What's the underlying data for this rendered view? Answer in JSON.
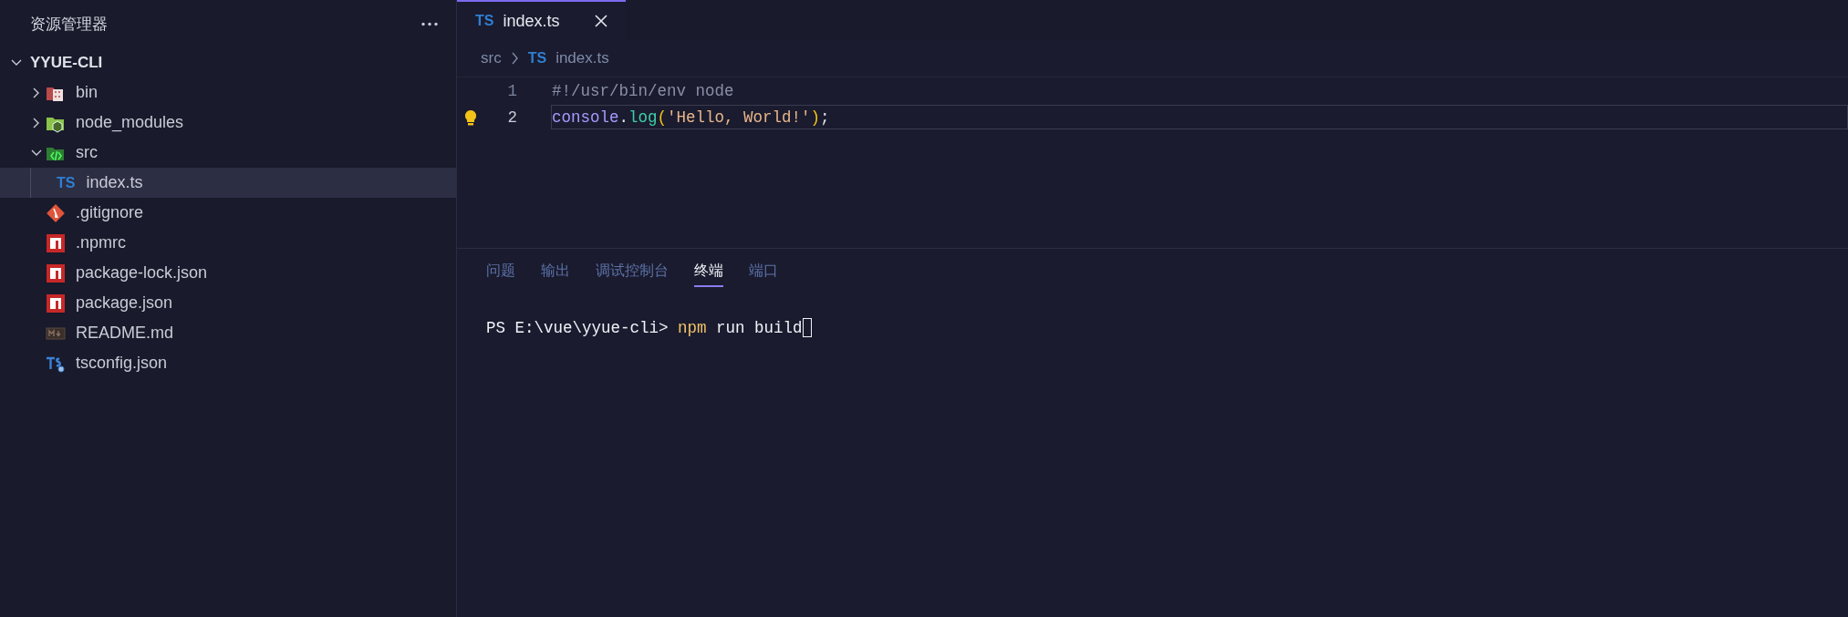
{
  "sidebar": {
    "title": "资源管理器",
    "tree": {
      "label": "YYUE-CLI",
      "expanded": true,
      "children": [
        {
          "label": "bin",
          "kind": "binfolder",
          "expanded": false,
          "selected": false
        },
        {
          "label": "node_modules",
          "kind": "nodefolder",
          "expanded": false,
          "selected": false
        },
        {
          "label": "src",
          "kind": "srcfolder",
          "expanded": true,
          "selected": false,
          "children": [
            {
              "label": "index.ts",
              "kind": "ts",
              "icon": "TS",
              "selected": true
            }
          ]
        },
        {
          "label": ".gitignore",
          "kind": "git",
          "selected": false
        },
        {
          "label": ".npmrc",
          "kind": "npm",
          "selected": false
        },
        {
          "label": "package-lock.json",
          "kind": "npm",
          "selected": false
        },
        {
          "label": "package.json",
          "kind": "npm",
          "selected": false
        },
        {
          "label": "README.md",
          "kind": "markdown",
          "selected": false
        },
        {
          "label": "tsconfig.json",
          "kind": "tsconfig",
          "selected": false
        }
      ]
    }
  },
  "editor": {
    "tabs": [
      {
        "label": "index.ts",
        "icon": "TS",
        "selected": true
      }
    ],
    "breadcrumb": [
      {
        "label": "src"
      },
      {
        "label": "index.ts",
        "icon": "TS"
      }
    ],
    "lines": [
      {
        "number": "1",
        "current": false,
        "lightbulb": false,
        "tokens": [
          {
            "text": "#!/usr/bin/env node",
            "kind": "comment"
          }
        ]
      },
      {
        "number": "2",
        "current": true,
        "lightbulb": true,
        "tokens": [
          {
            "text": "console",
            "kind": "variable"
          },
          {
            "text": ".",
            "kind": "plain"
          },
          {
            "text": "log",
            "kind": "function"
          },
          {
            "text": "(",
            "kind": "paren"
          },
          {
            "text": "'Hello, World!'",
            "kind": "string"
          },
          {
            "text": ")",
            "kind": "paren"
          },
          {
            "text": ";",
            "kind": "plain"
          }
        ]
      }
    ]
  },
  "panel": {
    "tabs": [
      {
        "label": "问题",
        "selected": false
      },
      {
        "label": "输出",
        "selected": false
      },
      {
        "label": "调试控制台",
        "selected": false
      },
      {
        "label": "终端",
        "selected": true
      },
      {
        "label": "端口",
        "selected": false
      }
    ],
    "terminal": {
      "lines": [
        {
          "tokens": [
            {
              "text": "PS E:\\vue\\yyue-cli> ",
              "kind": "prompt"
            },
            {
              "text": "npm",
              "kind": "command"
            },
            {
              "text": " run build",
              "kind": "argument"
            }
          ],
          "cursor": true
        }
      ]
    }
  }
}
